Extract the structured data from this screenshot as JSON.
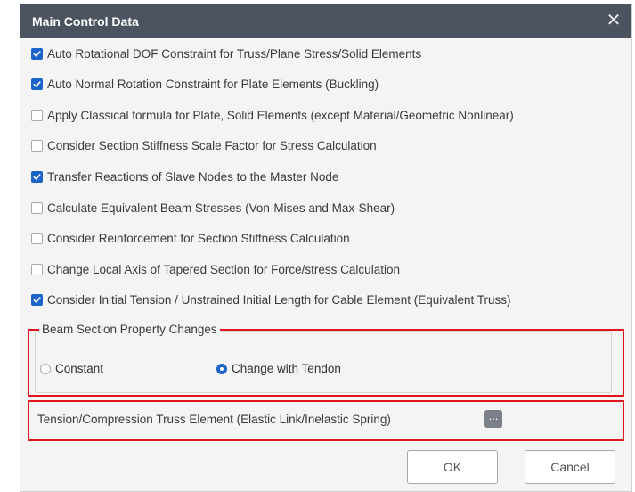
{
  "window": {
    "title": "Main Control Data",
    "close_glyph": "✕"
  },
  "options": [
    {
      "label": "Auto Rotational DOF Constraint for Truss/Plane Stress/Solid Elements",
      "checked": true
    },
    {
      "label": "Auto Normal Rotation Constraint for Plate Elements (Buckling)",
      "checked": true
    },
    {
      "label": "Apply Classical formula for Plate, Solid Elements (except Material/Geometric Nonlinear)",
      "checked": false
    },
    {
      "label": "Consider Section Stiffness Scale Factor for Stress Calculation",
      "checked": false
    },
    {
      "label": "Transfer Reactions of Slave Nodes to the Master Node",
      "checked": true
    },
    {
      "label": "Calculate Equivalent Beam Stresses (Von-Mises and Max-Shear)",
      "checked": false
    },
    {
      "label": "Consider Reinforcement for Section Stiffness Calculation",
      "checked": false
    },
    {
      "label": "Change Local Axis of Tapered Section for Force/stress Calculation",
      "checked": false
    },
    {
      "label": "Consider Initial Tension / Unstrained Initial Length for Cable Element (Equivalent Truss)",
      "checked": true
    }
  ],
  "beam_section": {
    "legend": "Beam Section Property Changes",
    "radios": [
      {
        "label": "Constant",
        "selected": false
      },
      {
        "label": "Change with Tendon",
        "selected": true
      }
    ]
  },
  "truss": {
    "label": "Tension/Compression Truss Element (Elastic Link/Inelastic Spring)",
    "button_label": "..."
  },
  "footer": {
    "ok_label": "OK",
    "cancel_label": "Cancel"
  },
  "colors": {
    "titlebar": "#4b5361",
    "accent": "#1d64c8",
    "highlight": "#e0141e"
  },
  "icons": {
    "close": "close-icon",
    "checkbox": "checkbox-icon",
    "radio": "radio-icon",
    "more": "ellipsis-icon"
  }
}
